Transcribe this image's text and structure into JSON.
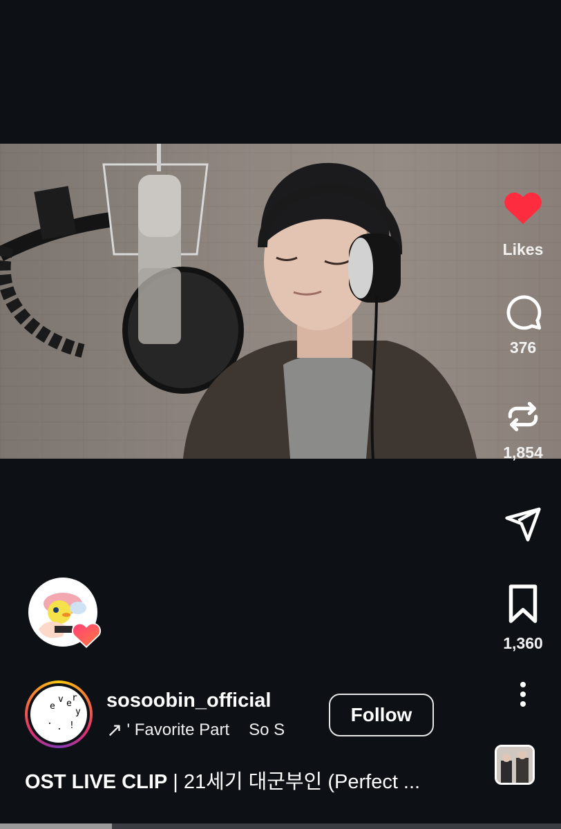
{
  "actions": {
    "likes_label": "Likes",
    "comments_count": "376",
    "reposts_count": "1,854",
    "saves_count": "1,360"
  },
  "author": {
    "username": "sosoobin_official",
    "avatar_letters": [
      "e",
      "v",
      "e",
      "r",
      "y",
      ".",
      ".",
      "!"
    ],
    "follow_label": "Follow"
  },
  "audio": {
    "arrow": "↗",
    "text_a": "' Favorite Part",
    "text_b": "So S"
  },
  "caption": {
    "bold": "OST LIVE CLIP",
    "rest": " | 21세기 대군부인 (Perfect ..."
  },
  "colors": {
    "like_heart": "#fe2c3f",
    "background": "#0d1116"
  },
  "playback": {
    "progress": 0.2
  }
}
